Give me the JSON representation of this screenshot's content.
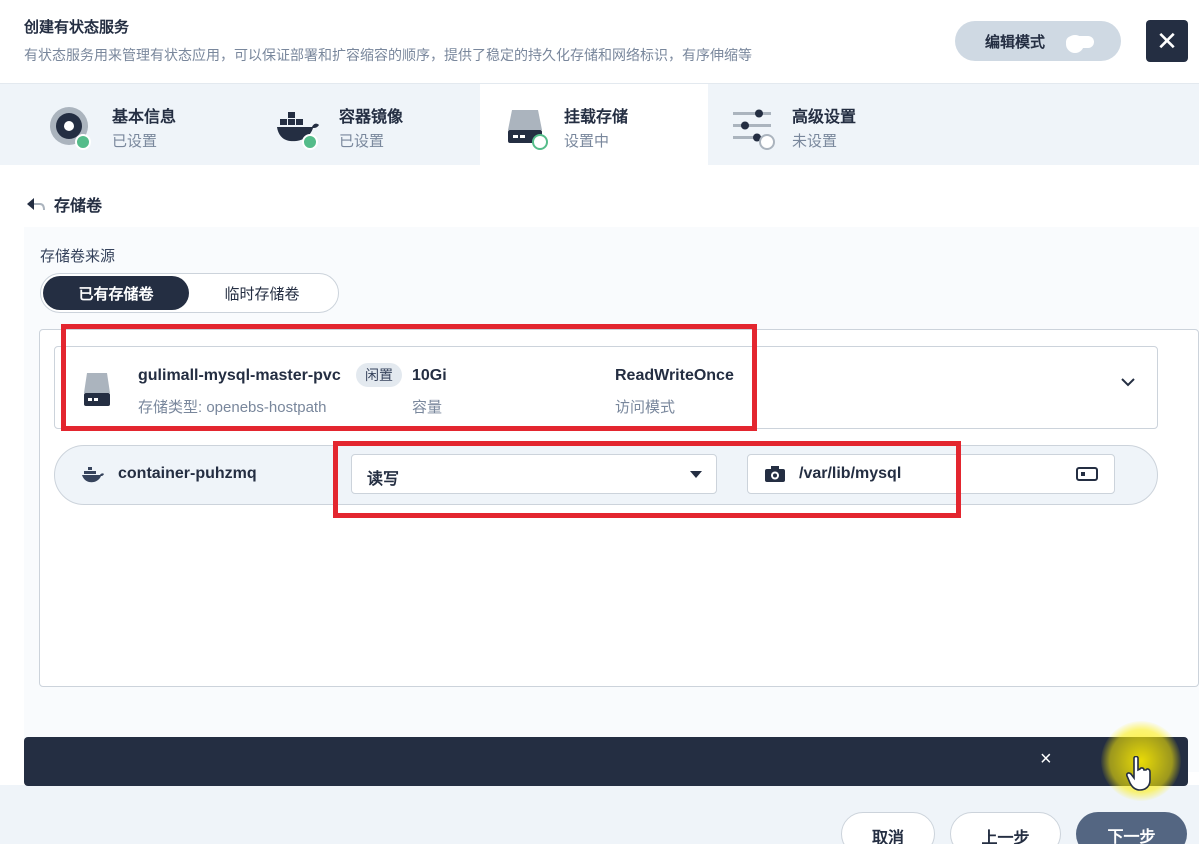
{
  "header": {
    "title": "创建有状态服务",
    "description": "有状态服务用来管理有状态应用，可以保证部署和扩容缩容的顺序，提供了稳定的持久化存储和网络标识，有序伸缩等",
    "edit_mode_label": "编辑模式",
    "close_symbol": "✕"
  },
  "steps": [
    {
      "label": "基本信息",
      "status": "已设置",
      "icon": "disc-icon"
    },
    {
      "label": "容器镜像",
      "status": "已设置",
      "icon": "docker-icon"
    },
    {
      "label": "挂载存储",
      "status": "设置中",
      "icon": "storage-disk-icon"
    },
    {
      "label": "高级设置",
      "status": "未设置",
      "icon": "sliders-icon"
    }
  ],
  "volume_section": {
    "back_label": "存储卷",
    "source_label": "存储卷来源",
    "source_options": [
      "已有存储卷",
      "临时存储卷"
    ],
    "selected_source": "已有存储卷"
  },
  "pvc": {
    "name": "gulimall-mysql-master-pvc",
    "tag": "闲置",
    "storage_type": "存储类型: openebs-hostpath",
    "capacity": "10Gi",
    "capacity_label": "容量",
    "access_mode": "ReadWriteOnce",
    "access_mode_label": "访问模式"
  },
  "mount": {
    "container_name": "container-puhzmq",
    "mode": "读写",
    "path": "/var/lib/mysql"
  },
  "notification": {
    "close_symbol": "×"
  },
  "footer": {
    "cancel_label": "取消",
    "prev_label": "上一步",
    "next_label": "下一步"
  },
  "colors": {
    "primary_dark": "#242e42",
    "success": "#55bc8a",
    "annotation_red": "#e3262f",
    "cursor_highlight": "#ffee00"
  }
}
